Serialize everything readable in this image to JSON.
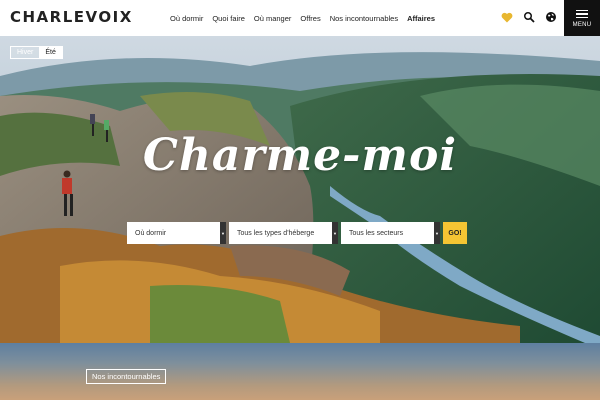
{
  "brand": {
    "logo_text": "CHARLEVOIX"
  },
  "nav": {
    "items": [
      {
        "label": "Où dormir"
      },
      {
        "label": "Quoi faire"
      },
      {
        "label": "Où manger"
      },
      {
        "label": "Offres"
      },
      {
        "label": "Nos incontournables"
      },
      {
        "label": "Affaires"
      }
    ]
  },
  "icons": {
    "favorite": "heart-icon",
    "search": "search-icon",
    "language": "globe-icon",
    "menu": "hamburger-icon"
  },
  "menu": {
    "label": "MENU"
  },
  "season": {
    "winter": "Hiver",
    "summer": "Été"
  },
  "hero": {
    "tagline": "Charme-moi"
  },
  "search": {
    "where_to_sleep": "Où dormir",
    "types": "Tous les types d'héberge",
    "sectors": "Tous les secteurs",
    "go": "GO!"
  },
  "lower": {
    "section_label": "Nos incontournables"
  },
  "colors": {
    "accent": "#f5c533",
    "header_bg": "#ffffff",
    "menu_bg": "#111111"
  }
}
